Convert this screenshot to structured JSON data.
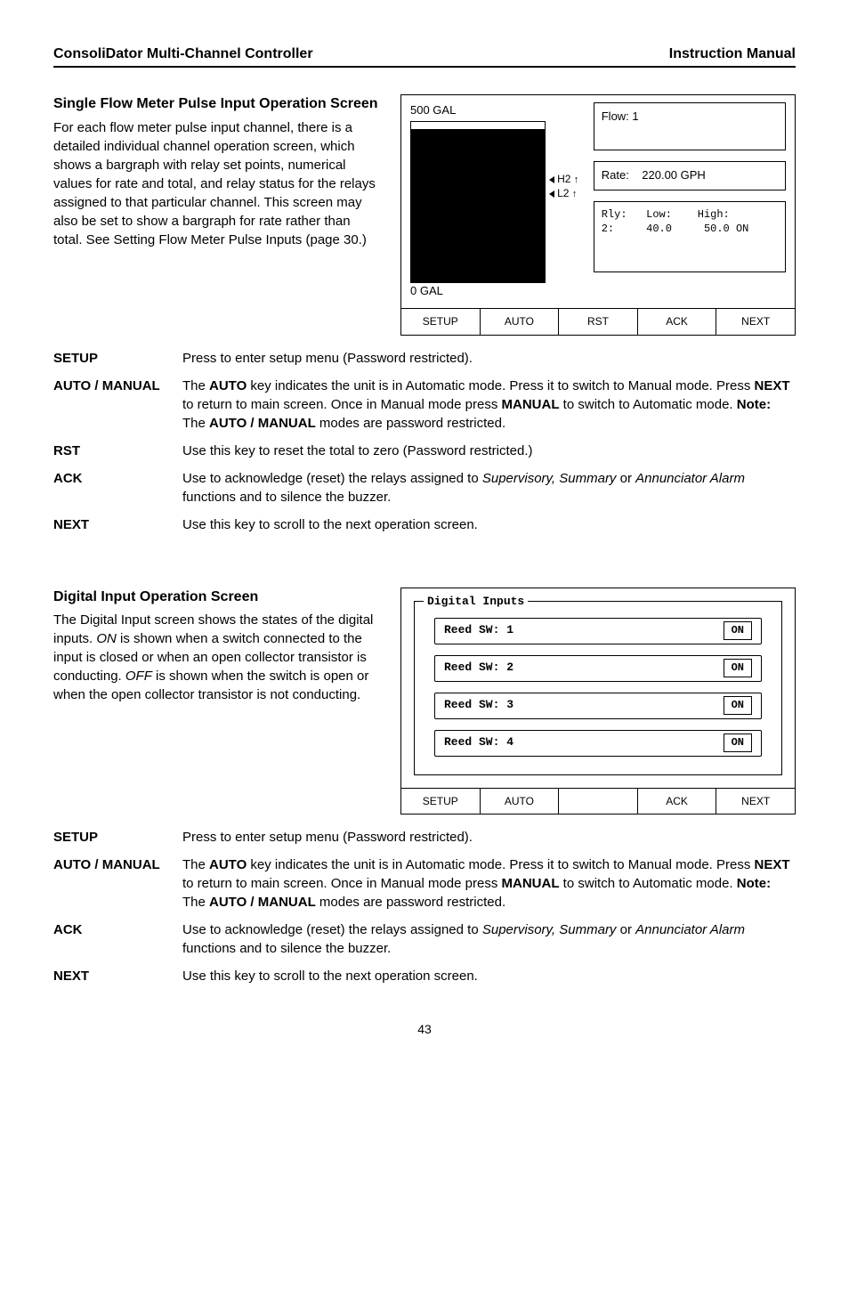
{
  "header": {
    "left": "ConsoliDator Multi-Channel Controller",
    "right": "Instruction Manual"
  },
  "section1": {
    "heading": "Single Flow Meter Pulse Input Operation Screen",
    "body": "For each flow meter pulse input channel, there is a detailed individual channel operation screen, which shows a bargraph with relay set points, numerical values for rate and total, and relay status for the relays assigned to that particular channel. This screen may also be set to show a bargraph for rate rather than total. See Setting Flow Meter Pulse Inputs (page 30.)"
  },
  "screen1": {
    "topLabel": "500 GAL",
    "bottomLabel": "0 GAL",
    "mark1": "H2",
    "mark2": "L2",
    "flowTitle": "Flow: 1",
    "rateLabel": "Rate:",
    "rateValue": "220.00 GPH",
    "relay": "Rly:   Low:    High:\n2:     40.0     50.0 ON",
    "buttons": {
      "b1": "SETUP",
      "b2": "AUTO",
      "b3": "RST",
      "b4": "ACK",
      "b5": "NEXT"
    }
  },
  "defs1": [
    {
      "term": "SETUP",
      "desc": "Press to enter setup menu (Password restricted)."
    },
    {
      "term": "AUTO / MANUAL",
      "desc": "The <b>AUTO</b> key indicates the unit is in Automatic mode. Press it to switch to Manual mode. Press <b>NEXT</b> to return to main screen. Once in Manual mode press <b>MANUAL</b> to switch to Automatic mode. <b>Note:</b> The <b>AUTO / MANUAL</b> modes are password restricted."
    },
    {
      "term": "RST",
      "desc": "Use this key to reset the total to zero (Password restricted.)"
    },
    {
      "term": "ACK",
      "desc": "Use to acknowledge (reset) the relays assigned to <i>Supervisory, Summary</i> or <i>Annunciator Alarm</i> functions and to silence the buzzer."
    },
    {
      "term": "NEXT",
      "desc": "Use this key to scroll to the next operation screen."
    }
  ],
  "section2": {
    "heading": "Digital Input Operation Screen",
    "body": "The Digital Input screen shows the states of the digital inputs. <i>ON</i> is shown when a switch connected to the input is closed or when an open collector transistor is conducting. <i>OFF</i> is shown when the switch is open or when the open collector transistor is not conducting."
  },
  "screen2": {
    "legend": "Digital Inputs",
    "rows": [
      {
        "label": "Reed SW: 1",
        "state": "ON"
      },
      {
        "label": "Reed SW: 2",
        "state": "ON"
      },
      {
        "label": "Reed SW: 3",
        "state": "ON"
      },
      {
        "label": "Reed SW: 4",
        "state": "ON"
      }
    ],
    "buttons": {
      "b1": "SETUP",
      "b2": "AUTO",
      "b3": "",
      "b4": "ACK",
      "b5": "NEXT"
    }
  },
  "defs2": [
    {
      "term": "SETUP",
      "desc": "Press to enter setup menu (Password restricted)."
    },
    {
      "term": "AUTO / MANUAL",
      "desc": "The <b>AUTO</b> key indicates the unit is in Automatic mode. Press it to switch to Manual mode. Press <b>NEXT</b> to return to main screen. Once in Manual mode press <b>MANUAL</b> to switch to Automatic mode. <b>Note:</b> The <b>AUTO / MANUAL</b> modes are password restricted."
    },
    {
      "term": "ACK",
      "desc": "Use to acknowledge (reset) the relays assigned to <i>Supervisory, Summary</i> or <i>Annunciator Alarm</i> functions and to silence the buzzer."
    },
    {
      "term": "NEXT",
      "desc": "Use this key to scroll to the next operation screen."
    }
  ],
  "pageNum": "43"
}
